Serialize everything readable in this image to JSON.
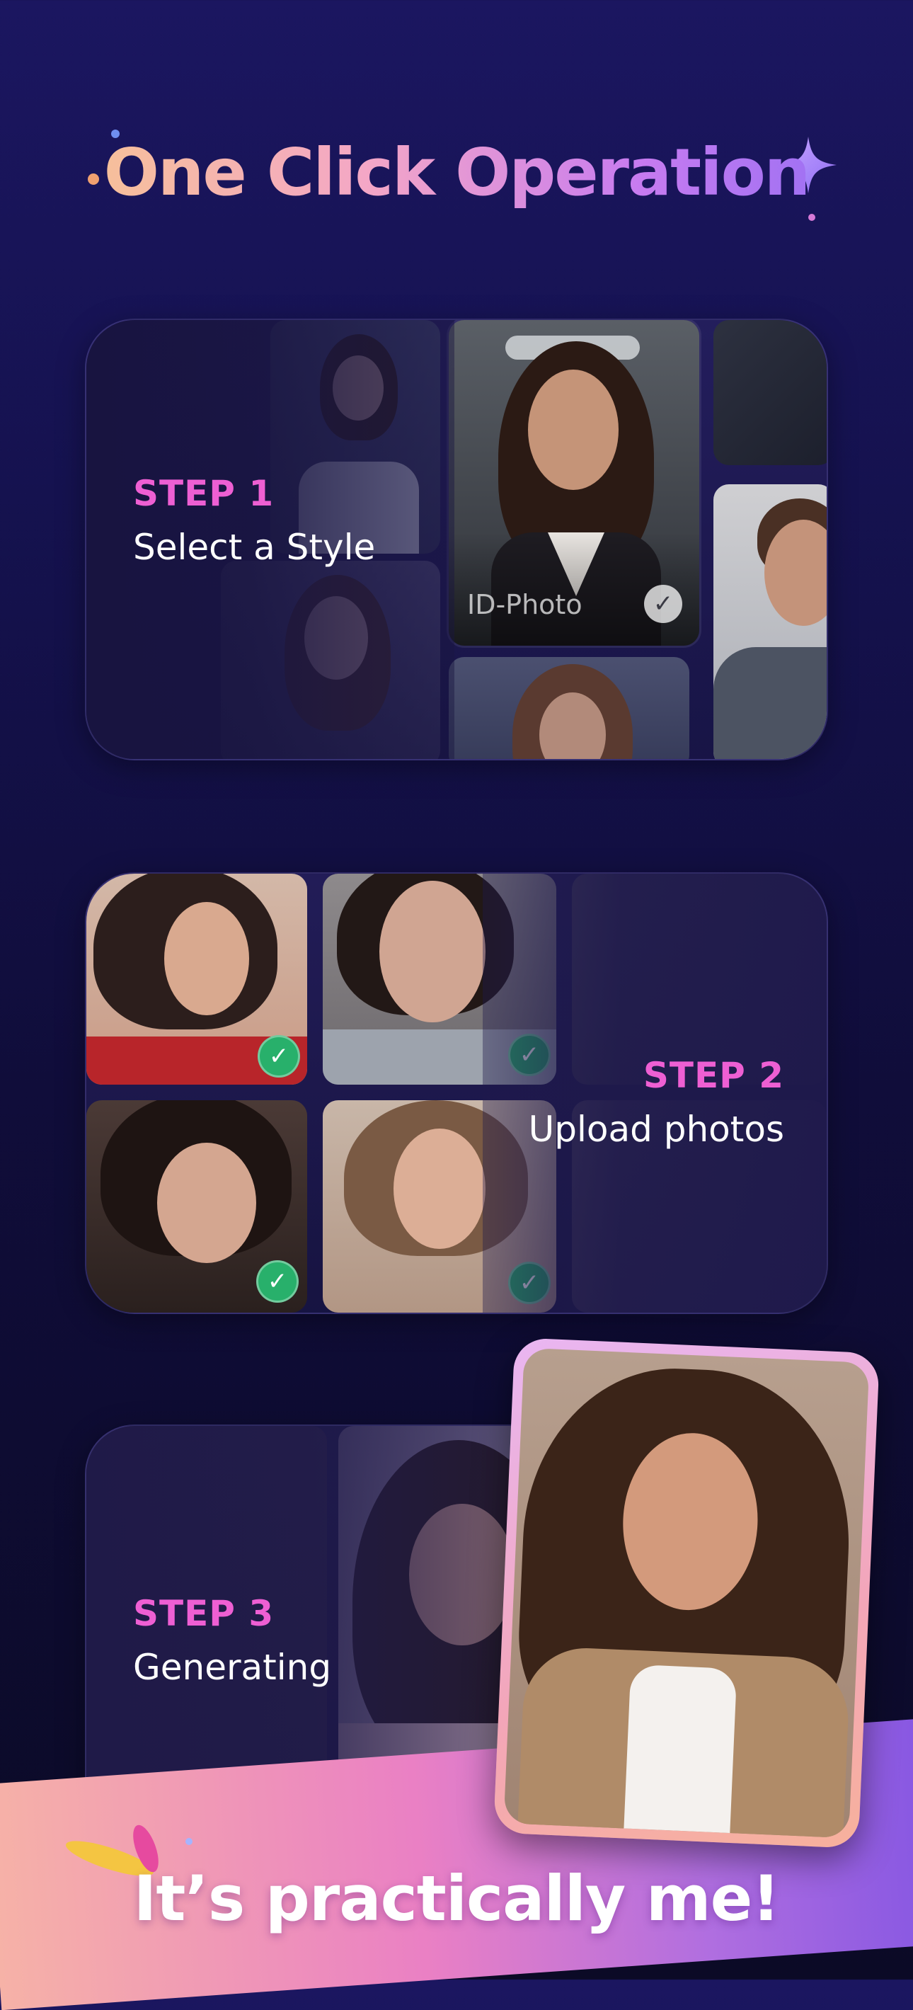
{
  "header": {
    "title": "One Click Operation"
  },
  "steps": [
    {
      "label": "STEP 1",
      "text": "Select a Style"
    },
    {
      "label": "STEP 2",
      "text": "Upload photos"
    },
    {
      "label": "STEP 3",
      "text": "Generating"
    }
  ],
  "style_picker": {
    "selected_style": "ID-Photo"
  },
  "footer": {
    "slogan": "It’s practically me!"
  },
  "colors": {
    "step_label": "#ee5fd3",
    "check_green": "#28b06b",
    "title_gradient": [
      "#f7c98a",
      "#f4a7c6",
      "#c77bf0",
      "#8b6cf5"
    ]
  },
  "icons": [
    "sparkle-icon",
    "check-icon"
  ]
}
